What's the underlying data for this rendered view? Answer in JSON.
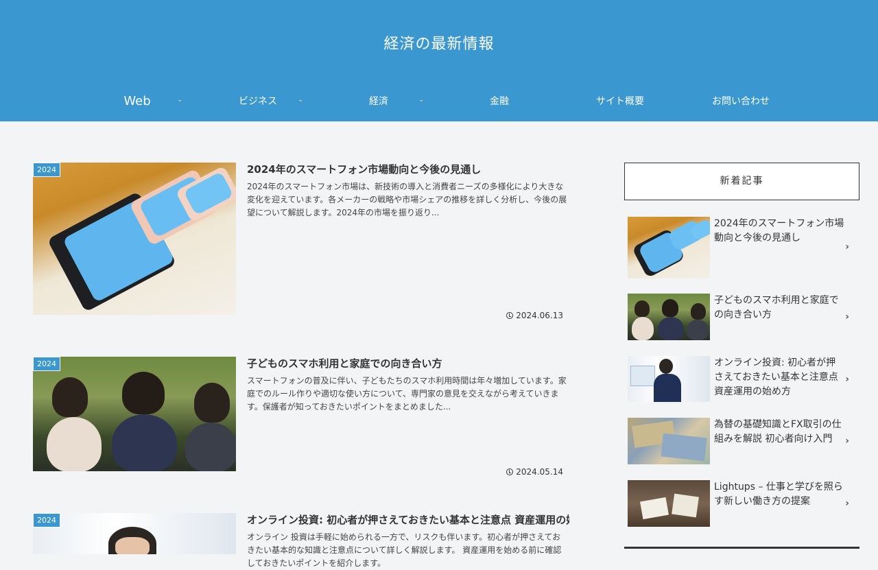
{
  "site": {
    "title": "経済の最新情報"
  },
  "nav": [
    {
      "label": "Web",
      "has_submenu": true
    },
    {
      "label": "ビジネス",
      "has_submenu": true
    },
    {
      "label": "経済",
      "has_submenu": true
    },
    {
      "label": "金融",
      "has_submenu": false
    },
    {
      "label": "サイト概要",
      "has_submenu": false
    },
    {
      "label": "お問い合わせ",
      "has_submenu": false
    }
  ],
  "posts": [
    {
      "category": "2024",
      "title": "2024年のスマートフォン市場動向と今後の見通し",
      "excerpt": "2024年のスマートフォン市場は、新技術の導入と消費者ニーズの多様化により大きな変化を迎えています。各メーカーの戦略や市場シェアの推移を詳しく分析し、今後の展望について解説します。2024年の市場を振り返り...",
      "date": "2024.06.13"
    },
    {
      "category": "2024",
      "title": "子どものスマホ利用と家庭での向き合い方",
      "excerpt": "スマートフォンの普及に伴い、子どもたちのスマホ利用時間は年々増加しています。家庭でのルール作りや適切な使い方について、専門家の意見を交えながら考えていきます。保護者が知っておきたいポイントをまとめました...",
      "date": "2024.05.14"
    },
    {
      "category": "2024",
      "title": "オンライン投資: 初心者が押さえておきたい基本と注意点 資産運用の始め方",
      "excerpt": "オンライン 投資は手軽に始められる一方で、リスクも伴います。初心者が押さえておきたい基本的な知識と注意点について詳しく解説します。 資産運用を始める前に確認しておきたいポイントを紹介します。",
      "date": ""
    }
  ],
  "sidebar": {
    "widget_title": "新着記事",
    "items": [
      {
        "title": "2024年のスマートフォン市場動向と今後の見通し"
      },
      {
        "title": "子どものスマホ利用と家庭での向き合い方"
      },
      {
        "title": "オンライン投資: 初心者が押さえておきたい基本と注意点 資産運用の始め方"
      },
      {
        "title": "為替の基礎知識とFX取引の仕組みを解説 初心者向け入門"
      },
      {
        "title": "Lightups – 仕事と学びを照らす新しい働き方の提案"
      }
    ]
  },
  "colors": {
    "accent": "#3a97d0",
    "background": "#f3f4f6"
  },
  "icons": {
    "chevron": "chevron-right-icon",
    "clock": "clock-icon",
    "submenu": "chevron-down-icon"
  }
}
